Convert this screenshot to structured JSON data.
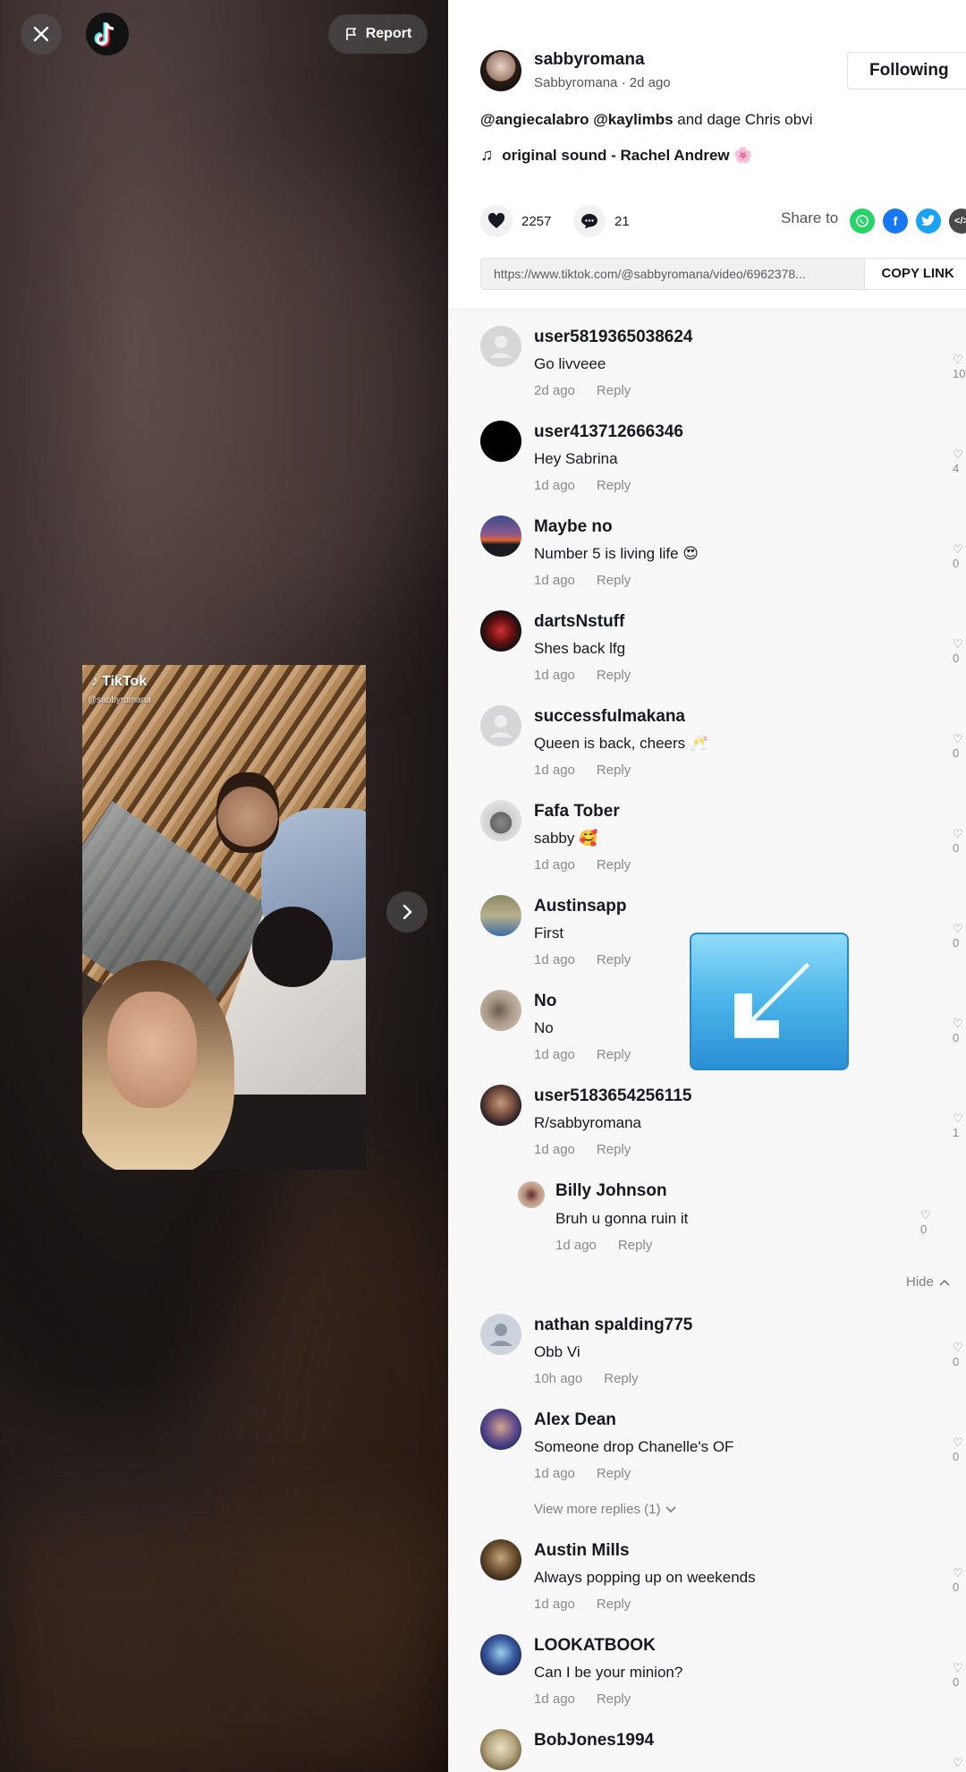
{
  "player": {
    "report_label": "Report",
    "watermark_brand": "TikTok",
    "watermark_handle": "@sabbyromana"
  },
  "author": {
    "username": "sabbyromana",
    "nickname": "Sabbyromana",
    "posted": "2d ago",
    "follow_label": "Following"
  },
  "description": {
    "mention1": "@angiecalabro",
    "mention2": "@kaylimbs",
    "text": "and dage Chris obvi"
  },
  "music": {
    "title": "original sound - Rachel Andrew 🌸"
  },
  "stats": {
    "likes": "2257",
    "comments": "21"
  },
  "share": {
    "label": "Share to",
    "link": "https://www.tiktok.com/@sabbyromana/video/6962378...",
    "copy_label": "COPY LINK"
  },
  "comments": [
    {
      "name": "user5819365038624",
      "text": "Go livveee",
      "time": "2d ago",
      "reply": "Reply",
      "likes": "10"
    },
    {
      "name": "user413712666346",
      "text": "Hey Sabrina",
      "time": "1d ago",
      "reply": "Reply",
      "likes": "4"
    },
    {
      "name": "Maybe no",
      "text": "Number 5 is living life 😍",
      "time": "1d ago",
      "reply": "Reply",
      "likes": "0"
    },
    {
      "name": "dartsNstuff",
      "text": "Shes back lfg",
      "time": "1d ago",
      "reply": "Reply",
      "likes": "0"
    },
    {
      "name": "successfulmakana",
      "text": "Queen is back, cheers 🥂",
      "time": "1d ago",
      "reply": "Reply",
      "likes": "0"
    },
    {
      "name": "Fafa Tober",
      "text": "sabby 🥰",
      "time": "1d ago",
      "reply": "Reply",
      "likes": "0"
    },
    {
      "name": "Austinsapp",
      "text": "First",
      "time": "1d ago",
      "reply": "Reply",
      "likes": "0"
    },
    {
      "name": "No",
      "text": "No",
      "time": "1d ago",
      "reply": "Reply",
      "likes": "0"
    },
    {
      "name": "user5183654256115",
      "text": "R/sabbyromana",
      "time": "1d ago",
      "reply": "Reply",
      "likes": "1"
    },
    {
      "name": "nathan spalding775",
      "text": "Obb Vi",
      "time": "10h ago",
      "reply": "Reply",
      "likes": "0"
    },
    {
      "name": "Alex Dean",
      "text": "Someone drop Chanelle's OF",
      "time": "1d ago",
      "reply": "Reply",
      "likes": "0"
    },
    {
      "name": "Austin Mills",
      "text": "Always popping up on weekends",
      "time": "1d ago",
      "reply": "Reply",
      "likes": "0"
    },
    {
      "name": "LOOKATBOOK",
      "text": "Can I be your minion?",
      "time": "1d ago",
      "reply": "Reply",
      "likes": "0"
    },
    {
      "name": "BobJones1994",
      "text": "",
      "time": "",
      "reply": "",
      "likes": ""
    }
  ],
  "nested_reply": {
    "name": "Billy Johnson",
    "text": "Bruh u gonna ruin it",
    "time": "1d ago",
    "reply": "Reply",
    "likes": "0"
  },
  "hide_label": "Hide",
  "view_more_label": "View more replies (1)",
  "colors": {
    "whatsapp": "#25d366",
    "facebook": "#1877f2",
    "twitter": "#1da1f2",
    "embed": "#4a4a4a",
    "arrow_box": "#4bb4ea"
  }
}
